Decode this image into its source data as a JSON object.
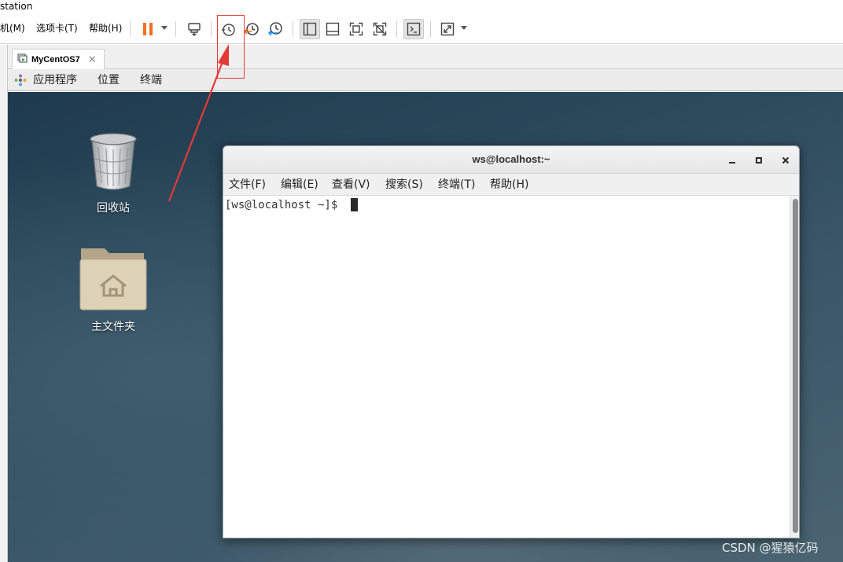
{
  "app": {
    "title_fragment": "station"
  },
  "toolbar": {
    "menus": [
      "机(M)",
      "选项卡(T)",
      "帮助(H)"
    ],
    "buttons": [
      "pause-icon",
      "send-ctrl-alt-del-icon",
      "snapshot-icon",
      "revert-snapshot-icon",
      "snapshot-manager-icon",
      "show-library-icon",
      "thumbnail-bar-icon",
      "full-screen-icon",
      "unity-icon",
      "console-view-icon",
      "stretch-guest-icon"
    ],
    "highlight_color": "#e53935"
  },
  "tabs": [
    {
      "label": "MyCentOS7",
      "close": "✕"
    }
  ],
  "gnome_bar": {
    "applications": "应用程序",
    "places": "位置",
    "terminal": "终端"
  },
  "desktop": {
    "icons": [
      {
        "label": "回收站",
        "icon": "trash-icon"
      },
      {
        "label": "主文件夹",
        "icon": "home-folder-icon"
      }
    ]
  },
  "terminal": {
    "title": "ws@localhost:~",
    "menu": [
      "文件(F)",
      "编辑(E)",
      "查看(V)",
      "搜索(S)",
      "终端(T)",
      "帮助(H)"
    ],
    "prompt": "[ws@localhost ~]$",
    "controls": {
      "minimize": "‒",
      "maximize": "□",
      "close": "✕"
    }
  },
  "watermark": "CSDN @猩猿亿码"
}
